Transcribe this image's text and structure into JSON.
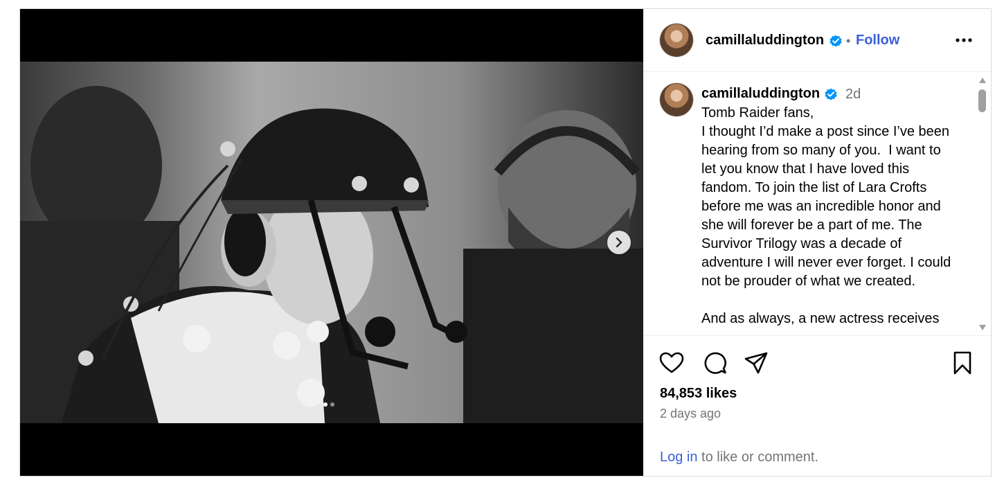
{
  "post": {
    "username": "camillaluddington",
    "separator": "•",
    "follow_label": "Follow",
    "more_icon": "more-horizontal-icon",
    "verified_color": "#0095f6",
    "caption_time": "2d",
    "caption_text": "Tomb Raider fans,\nI thought I’d make a post since I’ve been hearing from so many of you.  I want to let you know that I have loved this fandom. To join the list of Lara Crofts before me was an incredible honor and she will forever be a part of me. The Survivor Trilogy was a decade of adventure I will never ever forget. I could not be prouder of what we created.\n\nAnd as always, a new actress receives",
    "likes": "84,853 likes",
    "time_ago": "2 days ago",
    "login_link": "Log in",
    "login_suffix": " to like or comment."
  },
  "carousel": {
    "slide_count": 2,
    "current_slide": 1
  },
  "icons": {
    "like": "heart-icon",
    "comment": "comment-icon",
    "share": "send-icon",
    "save": "bookmark-icon",
    "next": "chevron-right-icon"
  }
}
